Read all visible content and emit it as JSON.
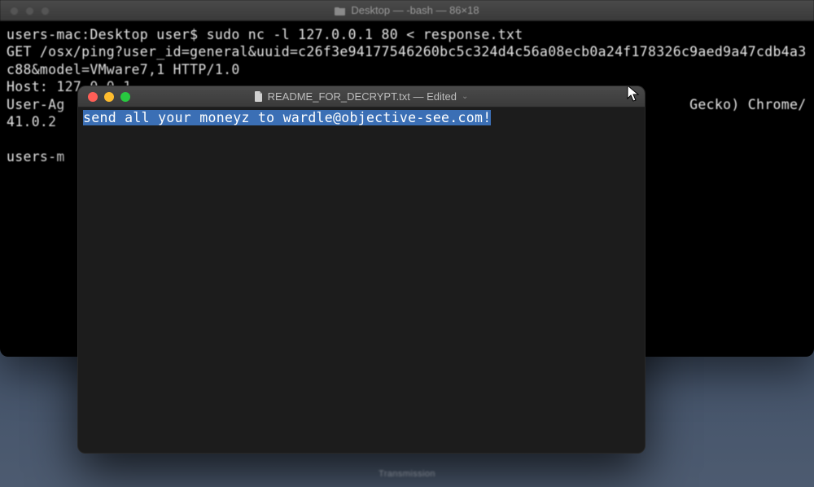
{
  "terminal": {
    "title": "Desktop — -bash — 86×18",
    "lines": [
      "users-mac:Desktop user$ sudo nc -l 127.0.0.1 80 < response.txt",
      "GET /osx/ping?user_id=general&uuid=c26f3e94177546260bc5c324d4c56a08ecb0a24f178326c9aed9a47cdb4a3c88&model=VMware7,1 HTTP/1.0",
      "Host: 127.0.0.1",
      "User-Ag                                                                           Gecko) Chrome/41.0.2",
      "",
      "users-m"
    ]
  },
  "textedit": {
    "title": "README_FOR_DECRYPT.txt — Edited",
    "content_selected": "send all your moneyz to wardle@objective-see.com!"
  },
  "dock": {
    "label": "Transmission"
  }
}
